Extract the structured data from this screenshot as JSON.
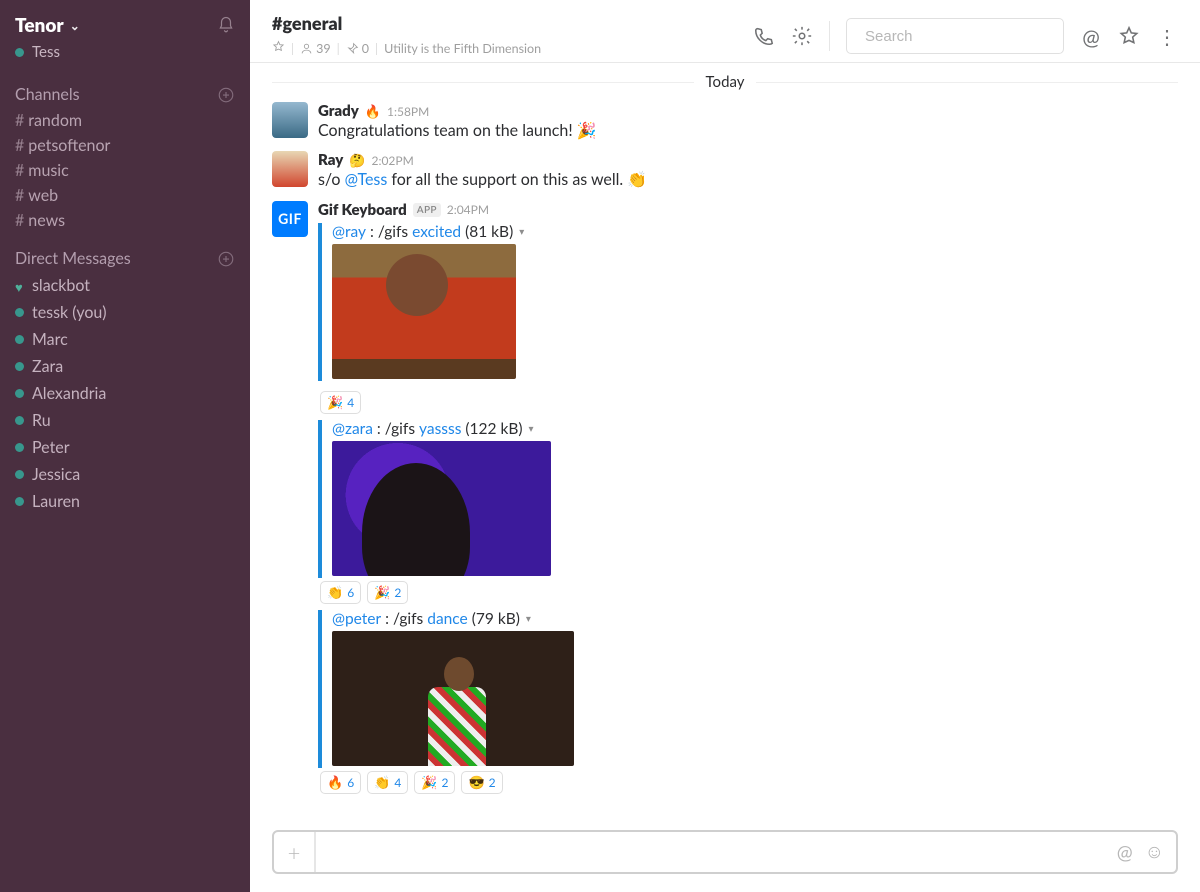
{
  "workspace": {
    "name": "Tenor",
    "user": "Tess"
  },
  "sidebar": {
    "channels_label": "Channels",
    "dm_label": "Direct Messages",
    "channels": [
      {
        "name": "random"
      },
      {
        "name": "petsoftenor"
      },
      {
        "name": "music"
      },
      {
        "name": "web"
      },
      {
        "name": "news"
      }
    ],
    "dms": [
      {
        "name": "slackbot",
        "heart": true
      },
      {
        "name": "tessk (you)"
      },
      {
        "name": "Marc"
      },
      {
        "name": "Zara"
      },
      {
        "name": "Alexandria"
      },
      {
        "name": "Ru"
      },
      {
        "name": "Peter"
      },
      {
        "name": "Jessica"
      },
      {
        "name": "Lauren"
      }
    ]
  },
  "header": {
    "channel": "#general",
    "members": "39",
    "pins": "0",
    "topic": "Utility is the Fifth Dimension",
    "search_placeholder": "Search"
  },
  "divider": "Today",
  "messages": [
    {
      "author": "Grady",
      "emoji": "🔥",
      "time": "1:58PM",
      "text_pre": "Congratulations team on the launch! ",
      "text_emoji": "🎉"
    },
    {
      "author": "Ray",
      "emoji": "🤔",
      "time": "2:02PM",
      "text_pre": "s/o  ",
      "mention": "@Tess",
      "text_post": " for all the support on this as well. ",
      "text_emoji": "👏"
    }
  ],
  "gifbot": {
    "author": "Gif Keyboard",
    "badge": "APP",
    "time": "2:04PM",
    "items": [
      {
        "user": "@ray",
        "cmd": ": /gifs ",
        "kw": "excited",
        "size": " (81 kB) ",
        "reacts": [
          {
            "e": "🎉",
            "n": "4"
          }
        ]
      },
      {
        "user": "@zara",
        "cmd": ": /gifs ",
        "kw": "yassss",
        "size": " (122 kB) ",
        "reacts": [
          {
            "e": "👏",
            "n": "6"
          },
          {
            "e": "🎉",
            "n": "2"
          }
        ]
      },
      {
        "user": "@peter",
        "cmd": ": /gifs ",
        "kw": "dance",
        "size": " (79 kB) ",
        "reacts": [
          {
            "e": "🔥",
            "n": "6"
          },
          {
            "e": "👏",
            "n": "4"
          },
          {
            "e": "🎉",
            "n": "2"
          },
          {
            "e": "😎",
            "n": "2"
          }
        ]
      }
    ]
  }
}
